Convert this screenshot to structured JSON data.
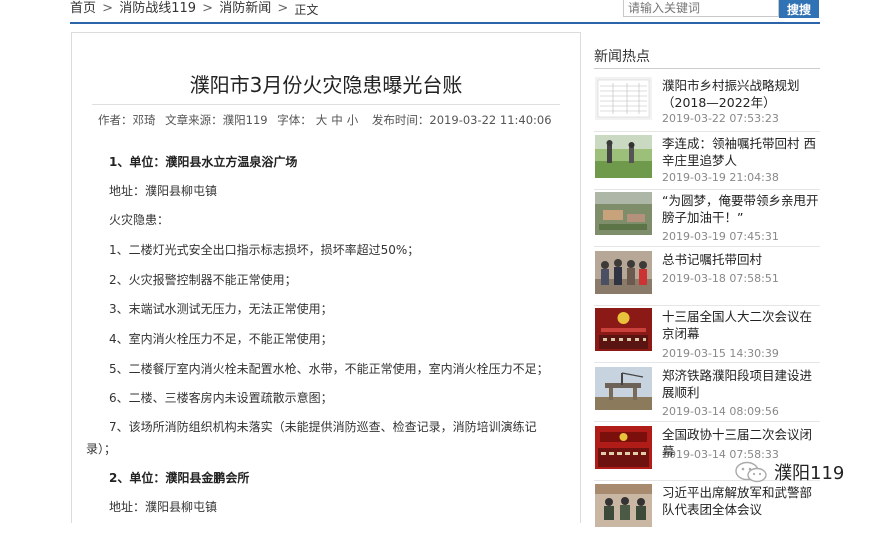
{
  "breadcrumb": {
    "items": [
      "首页",
      "消防战线119",
      "消防新闻"
    ],
    "separator": ">",
    "current": "正文"
  },
  "search": {
    "placeholder": "请输入关键词",
    "button_label": "搜搜"
  },
  "article": {
    "title": "濮阳市3月份火灾隐患曝光台账",
    "meta": {
      "author": "作者：邓琦",
      "source": "文章来源：濮阳119",
      "font_label": "字体：",
      "font_sizes": [
        "大",
        "中",
        "小"
      ],
      "publish_time": "发布时间：2019-03-22 11:40:06"
    },
    "lines": [
      {
        "text": "1、单位：濮阳县水立方温泉浴广场",
        "bold": true
      },
      {
        "text": "地址：濮阳县柳屯镇",
        "bold": false
      },
      {
        "text": "火灾隐患：",
        "bold": false
      },
      {
        "text": "1、二楼灯光式安全出口指示标志损坏，损坏率超过50%；",
        "bold": false
      },
      {
        "text": "2、火灾报警控制器不能正常使用；",
        "bold": false
      },
      {
        "text": "3、末端试水测试无压力，无法正常使用；",
        "bold": false
      },
      {
        "text": "4、室内消火栓压力不足，不能正常使用；",
        "bold": false
      },
      {
        "text": "5、二楼餐厅室内消火栓未配置水枪、水带，不能正常使用，室内消火栓压力不足；",
        "bold": false
      },
      {
        "text": "6、二楼、三楼客房内未设置疏散示意图；",
        "bold": false
      },
      {
        "text": "7、该场所消防组织机构未落实（未能提供消防巡查、检查记录，消防培训演练记",
        "bold": false
      },
      {
        "text": "录）；",
        "bold": false
      },
      {
        "text": "2、单位：濮阳县金鹏会所",
        "bold": true
      },
      {
        "text": "地址：濮阳县柳屯镇",
        "bold": false
      }
    ]
  },
  "sidebar": {
    "heading": "新闻热点",
    "news": [
      {
        "title": "濮阳市乡村振兴战略规划（2018—2022年）",
        "date": "2019-03-22 07:53:23",
        "thumb": "document-table"
      },
      {
        "title": "李连成：领袖嘱托带回村 西辛庄里追梦人",
        "date": "2019-03-19 21:04:38",
        "thumb": "field-people"
      },
      {
        "title": "“为圆梦，俺要带领乡亲甩开膀子加油干！”",
        "date": "2019-03-19 07:45:31",
        "thumb": "aerial-village"
      },
      {
        "title": "总书记嘱托带回村",
        "date": "2019-03-18 07:58:51",
        "thumb": "group-people"
      },
      {
        "title": "十三届全国人大二次会议在京闭幕",
        "date": "2019-03-15 14:30:39",
        "thumb": "assembly-hall"
      },
      {
        "title": "郑济铁路濮阳段项目建设进展顺利",
        "date": "2019-03-14 08:09:56",
        "thumb": "construction"
      },
      {
        "title": "全国政协十三届二次会议闭幕",
        "date": "2019-03-14 07:58:33",
        "thumb": "assembly-hall-2"
      },
      {
        "title": "习近平出席解放军和武警部队代表团全体会议",
        "date": "",
        "thumb": "meeting"
      }
    ]
  },
  "watermark": {
    "text": "濮阳119"
  },
  "colors": {
    "accent": "#2b64a8",
    "search_button": "#2f73b5"
  }
}
